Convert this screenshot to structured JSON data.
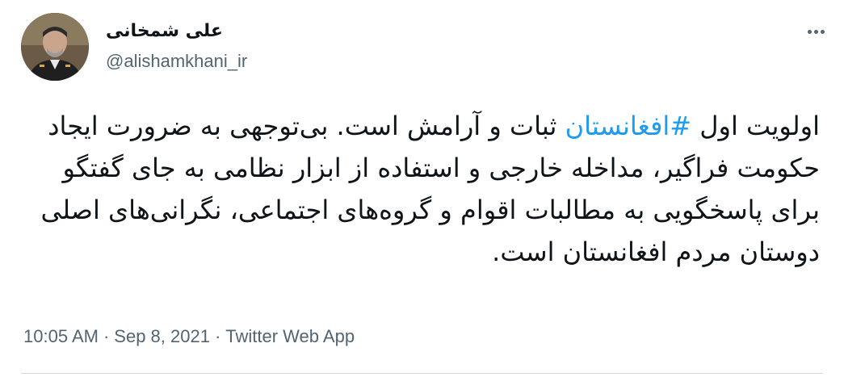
{
  "author": {
    "display_name": "علی شمخانی",
    "handle": "@alishamkhani_ir",
    "avatar_icon": "profile-photo"
  },
  "more_icon": "more-horizontal-icon",
  "tweet": {
    "text_before": "اولویت اول ",
    "hashtag": "#افغانستان",
    "text_after": " ثبات و آرامش است. بی‌توجهی به ضرورت ایجاد حکومت فراگیر، مداخله خارجی و استفاده از ابزار نظامی به جای گفتگو برای پاسخگویی به مطالبات اقوام و گروه‌های اجتماعی، نگرانی‌های اصلی دوستان مردم افغانستان است."
  },
  "meta": {
    "time": "10:05 AM",
    "separator": "·",
    "date": "Sep 8, 2021",
    "source": "Twitter Web App"
  },
  "colors": {
    "link": "#1d9bf0",
    "secondary": "#536471",
    "text": "#0f1419"
  }
}
